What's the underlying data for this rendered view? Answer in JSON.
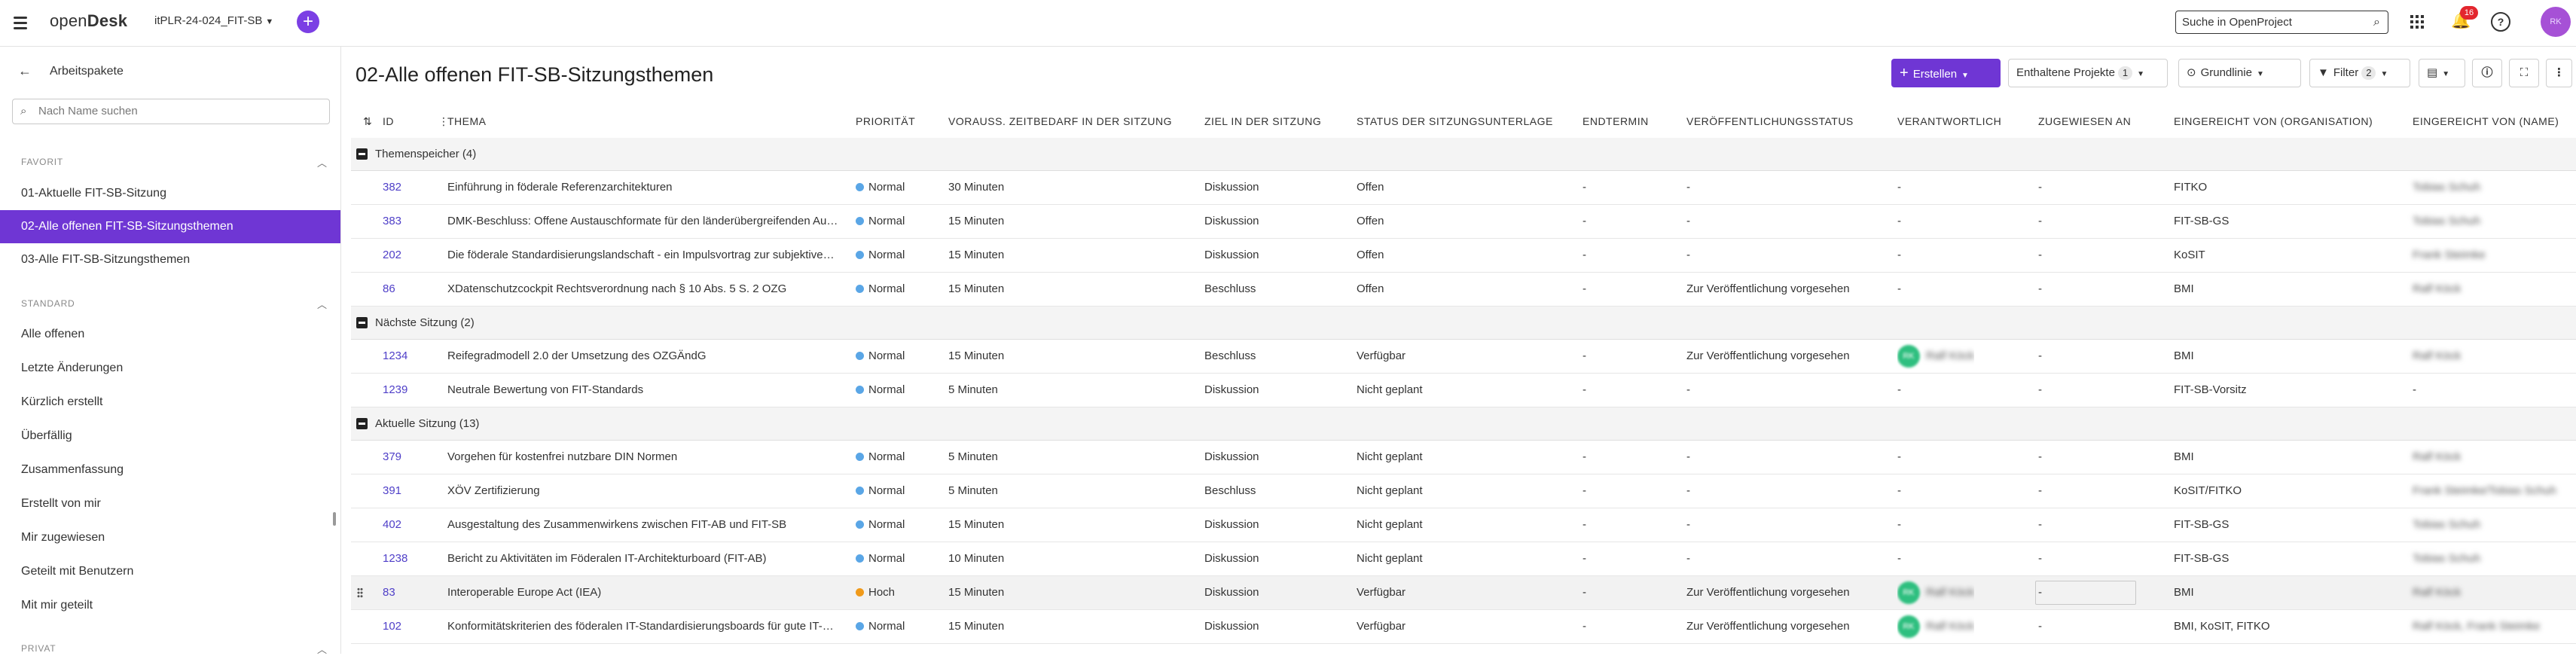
{
  "header": {
    "logo_light": "open",
    "logo_bold": "Desk",
    "project": "itPLR-24-024_FIT-SB",
    "search_placeholder": "Suche in OpenProject",
    "notification_count": "16",
    "avatar_initials": "RK"
  },
  "sidebar": {
    "title": "Arbeitspakete",
    "search_placeholder": "Nach Name suchen",
    "sections": [
      {
        "label": "FAVORIT",
        "items": [
          "01-Aktuelle FIT-SB-Sitzung",
          "02-Alle offenen FIT-SB-Sitzungsthemen",
          "03-Alle FIT-SB-Sitzungsthemen"
        ]
      },
      {
        "label": "STANDARD",
        "items": [
          "Alle offenen",
          "Letzte Änderungen",
          "Kürzlich erstellt",
          "Überfällig",
          "Zusammenfassung",
          "Erstellt von mir",
          "Mir zugewiesen",
          "Geteilt mit Benutzern",
          "Mit mir geteilt"
        ]
      },
      {
        "label": "PRIVAT",
        "items": []
      }
    ],
    "active_item": "02-Alle offenen FIT-SB-Sitzungsthemen"
  },
  "main": {
    "title": "02-Alle offenen FIT-SB-Sitzungsthemen",
    "toolbar": {
      "create_label": "Erstellen",
      "projects_label": "Enthaltene Projekte",
      "projects_count": "1",
      "baseline_label": "Grundlinie",
      "filter_label": "Filter",
      "filter_count": "2"
    },
    "columns": [
      "ID",
      "THEMA",
      "PRIORITÄT",
      "VORAUSS. ZEITBEDARF IN DER SITZUNG",
      "ZIEL IN DER SITZUNG",
      "STATUS DER SITZUNGSUNTERLAGE",
      "ENDTERMIN",
      "VERÖFFENTLICHUNGSSTATUS",
      "VERANTWORTLICH",
      "ZUGEWIESEN AN",
      "EINGEREICHT VON (ORGANISATION)",
      "EINGEREICHT VON (NAME)"
    ],
    "groups": [
      {
        "label": "Themenspeicher (4)",
        "rows": [
          {
            "id": "382",
            "subject": "Einführung in föderale Referenzarchitekturen",
            "priority": "Normal",
            "time": "30 Minuten",
            "goal": "Diskussion",
            "status": "Offen",
            "due": "-",
            "pub": "-",
            "resp": "-",
            "resp_avatar": "",
            "assignee": "-",
            "org": "FITKO",
            "name": "Tobias Schuh"
          },
          {
            "id": "383",
            "subject": "DMK-Beschluss: Offene Austauschformate für den länderübergreifenden Austausch",
            "priority": "Normal",
            "time": "15 Minuten",
            "goal": "Diskussion",
            "status": "Offen",
            "due": "-",
            "pub": "-",
            "resp": "-",
            "resp_avatar": "",
            "assignee": "-",
            "org": "FIT-SB-GS",
            "name": "Tobias Schuh"
          },
          {
            "id": "202",
            "subject": "Die föderale Standardisierungslandschaft - ein Impulsvortrag zur subjektiven Einordnung",
            "priority": "Normal",
            "time": "15 Minuten",
            "goal": "Diskussion",
            "status": "Offen",
            "due": "-",
            "pub": "-",
            "resp": "-",
            "resp_avatar": "",
            "assignee": "-",
            "org": "KoSIT",
            "name": "Frank Steimke"
          },
          {
            "id": "86",
            "subject": "XDatenschutzcockpit Rechtsverordnung nach § 10 Abs. 5 S. 2 OZG",
            "priority": "Normal",
            "time": "15 Minuten",
            "goal": "Beschluss",
            "status": "Offen",
            "due": "-",
            "pub": "Zur Veröffentlichung vorgesehen",
            "resp": "-",
            "resp_avatar": "",
            "assignee": "-",
            "org": "BMI",
            "name": "Ralf Köck"
          }
        ]
      },
      {
        "label": "Nächste Sitzung (2)",
        "rows": [
          {
            "id": "1234",
            "subject": "Reifegradmodell 2.0 der Umsetzung des OZGÄndG",
            "priority": "Normal",
            "time": "15 Minuten",
            "goal": "Beschluss",
            "status": "Verfügbar",
            "due": "-",
            "pub": "Zur Veröffentlichung vorgesehen",
            "resp": "Ralf Köck",
            "resp_avatar": "RK",
            "assignee": "-",
            "org": "BMI",
            "name": "Ralf Köck"
          },
          {
            "id": "1239",
            "subject": "Neutrale Bewertung von FIT-Standards",
            "priority": "Normal",
            "time": "5 Minuten",
            "goal": "Diskussion",
            "status": "Nicht geplant",
            "due": "-",
            "pub": "-",
            "resp": "-",
            "resp_avatar": "",
            "assignee": "-",
            "org": "FIT-SB-Vorsitz",
            "name": "-"
          }
        ]
      },
      {
        "label": "Aktuelle Sitzung (13)",
        "rows": [
          {
            "id": "379",
            "subject": "Vorgehen für kostenfrei nutzbare DIN Normen",
            "priority": "Normal",
            "time": "5 Minuten",
            "goal": "Diskussion",
            "status": "Nicht geplant",
            "due": "-",
            "pub": "-",
            "resp": "-",
            "resp_avatar": "",
            "assignee": "-",
            "org": "BMI",
            "name": "Ralf Köck"
          },
          {
            "id": "391",
            "subject": "XÖV Zertifizierung",
            "priority": "Normal",
            "time": "5 Minuten",
            "goal": "Beschluss",
            "status": "Nicht geplant",
            "due": "-",
            "pub": "-",
            "resp": "-",
            "resp_avatar": "",
            "assignee": "-",
            "org": "KoSIT/FITKO",
            "name": "Frank Steimke/Tobias Schuh"
          },
          {
            "id": "402",
            "subject": "Ausgestaltung des Zusammenwirkens zwischen FIT-AB und FIT-SB",
            "priority": "Normal",
            "time": "15 Minuten",
            "goal": "Diskussion",
            "status": "Nicht geplant",
            "due": "-",
            "pub": "-",
            "resp": "-",
            "resp_avatar": "",
            "assignee": "-",
            "org": "FIT-SB-GS",
            "name": "Tobias Schuh"
          },
          {
            "id": "1238",
            "subject": "Bericht zu Aktivitäten im Föderalen IT-Architekturboard (FIT-AB)",
            "priority": "Normal",
            "time": "10 Minuten",
            "goal": "Diskussion",
            "status": "Nicht geplant",
            "due": "-",
            "pub": "-",
            "resp": "-",
            "resp_avatar": "",
            "assignee": "-",
            "org": "FIT-SB-GS",
            "name": "Tobias Schuh"
          },
          {
            "id": "83",
            "subject": "Interoperable Europe Act (IEA)",
            "priority": "Hoch",
            "time": "15 Minuten",
            "goal": "Diskussion",
            "status": "Verfügbar",
            "due": "-",
            "pub": "Zur Veröffentlichung vorgesehen",
            "resp": "Ralf Köck",
            "resp_avatar": "RK",
            "assignee": "-",
            "org": "BMI",
            "name": "Ralf Köck"
          },
          {
            "id": "102",
            "subject": "Konformitätskriterien des föderalen IT-Standardisierungsboards für gute IT-Standards",
            "priority": "Normal",
            "time": "15 Minuten",
            "goal": "Diskussion",
            "status": "Verfügbar",
            "due": "-",
            "pub": "Zur Veröffentlichung vorgesehen",
            "resp": "Ralf Köck",
            "resp_avatar": "RK",
            "assignee": "-",
            "org": "BMI, KoSIT, FITKO",
            "name": "Ralf Köck, Frank Steimke"
          }
        ]
      }
    ]
  },
  "colors": {
    "accent": "#6f36d4",
    "normal_priority": "#5aa6e6",
    "high_priority": "#f09a1a",
    "id_link": "#4f3fc8"
  }
}
